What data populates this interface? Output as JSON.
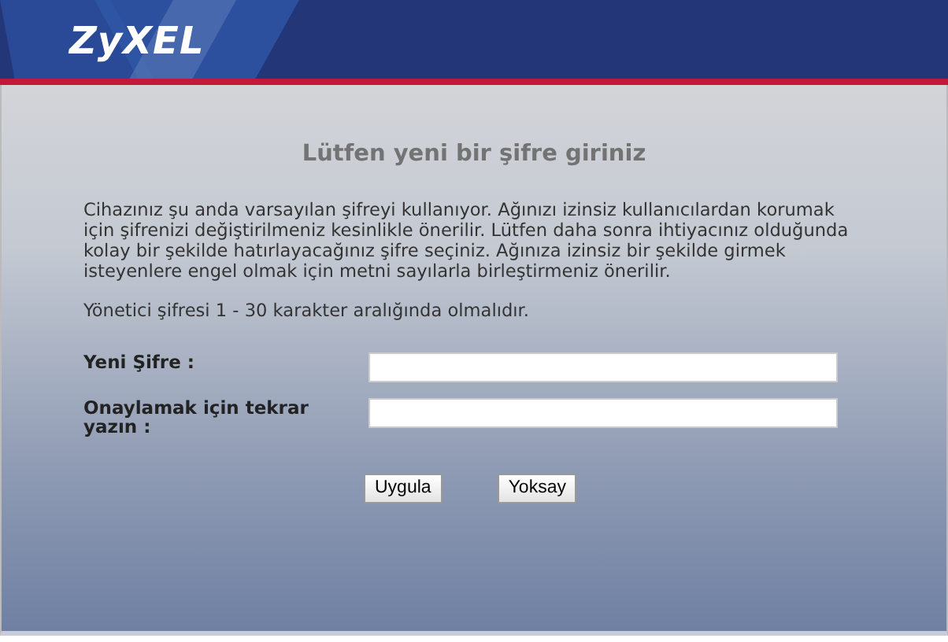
{
  "header": {
    "logo": "ZyXEL"
  },
  "title": "Lütfen yeni bir şifre giriniz",
  "paragraphs": [
    "Cihazınız şu anda varsayılan şifreyi kullanıyor. Ağınızı izinsiz kullanıcılardan korumak için şifrenizi değiştirilmeniz kesinlikle önerilir. Lütfen daha sonra ihtiyacınız olduğunda kolay bir şekilde hatırlayacağınız şifre seçiniz. Ağınıza izinsiz bir şekilde girmek isteyenlere engel olmak için metni sayılarla birleştirmeniz önerilir.",
    "Yönetici şifresi 1 - 30 karakter aralığında olmalıdır."
  ],
  "fields": [
    {
      "label": "Yeni Şifre :"
    },
    {
      "label": "Onaylamak için tekrar yazın :"
    }
  ],
  "buttons": [
    "Uygula",
    "Yoksay"
  ]
}
